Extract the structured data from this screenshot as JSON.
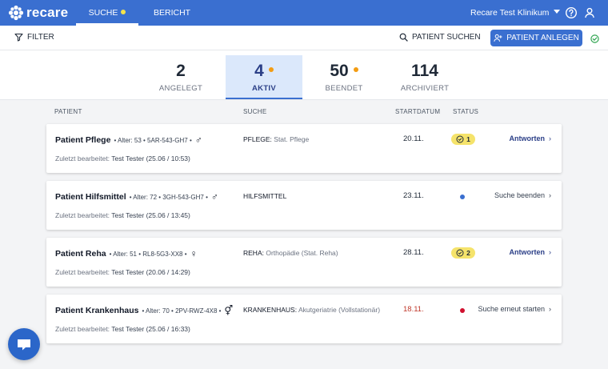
{
  "app": {
    "brand": "recare"
  },
  "nav": {
    "tabs": [
      {
        "label": "SUCHE",
        "active": true
      },
      {
        "label": "BERICHT",
        "active": false
      }
    ],
    "clinic": "Recare Test Klinikum"
  },
  "toolbar": {
    "filter_label": "FILTER",
    "search_patient_label": "PATIENT SUCHEN",
    "add_patient_label": "PATIENT ANLEGEN"
  },
  "counters": [
    {
      "value": "2",
      "label": "ANGELEGT",
      "active": false,
      "dot": false
    },
    {
      "value": "4",
      "label": "AKTIV",
      "active": true,
      "dot": true
    },
    {
      "value": "50",
      "label": "BEENDET",
      "active": false,
      "dot": true
    },
    {
      "value": "114",
      "label": "ARCHIVIERT",
      "active": false,
      "dot": false
    }
  ],
  "table": {
    "headers": {
      "patient": "PATIENT",
      "search": "SUCHE",
      "start": "STARTDATUM",
      "status": "STATUS"
    },
    "edited_prefix": "Zuletzt bearbeitet:",
    "rows": [
      {
        "name": "Patient Pflege",
        "details": "• Alter: 53 • 5AR-543-GH7 •",
        "sex": "♂",
        "search_type": "PFLEGE:",
        "search_detail": "Stat. Pflege",
        "start": "20.11.",
        "start_overdue": false,
        "status_kind": "badge",
        "status_count": "1",
        "action": "Antworten",
        "action_primary": true,
        "edited": "Test Tester (25.06 / 10:53)"
      },
      {
        "name": "Patient Hilfsmittel",
        "details": "• Alter: 72 • 3GH-543-GH7 •",
        "sex": "♂",
        "search_type": "HILFSMITTEL",
        "search_detail": "",
        "start": "23.11.",
        "start_overdue": false,
        "status_kind": "dot",
        "status_color": "#3a6fd0",
        "action": "Suche beenden",
        "action_primary": false,
        "edited": "Test Tester (25.06 / 13:45)"
      },
      {
        "name": "Patient Reha",
        "details": "• Alter: 51 • RL8-5G3-XX8 •",
        "sex": "♀",
        "search_type": "REHA:",
        "search_detail": "Orthopädie (Stat. Reha)",
        "start": "28.11.",
        "start_overdue": false,
        "status_kind": "badge",
        "status_count": "2",
        "action": "Antworten",
        "action_primary": true,
        "edited": "Test Tester (20.06 / 14:29)"
      },
      {
        "name": "Patient Krankenhaus",
        "details": "• Alter: 70 • 2PV-RWZ-4X8 •",
        "sex": "⚥",
        "search_type": "KRANKENHAUS:",
        "search_detail": "Akutgeriatrie (Vollstationär)",
        "start": "18.11.",
        "start_overdue": true,
        "status_kind": "dot",
        "status_color": "#d0102e",
        "action": "Suche erneut starten",
        "action_primary": false,
        "edited": "Test Tester (25.06 / 16:33)"
      }
    ]
  },
  "colors": {
    "primary": "#3a6fd0",
    "badge_yellow": "#f5e36b",
    "overdue_red": "#c0392b",
    "ok_green": "#2ea44f"
  }
}
